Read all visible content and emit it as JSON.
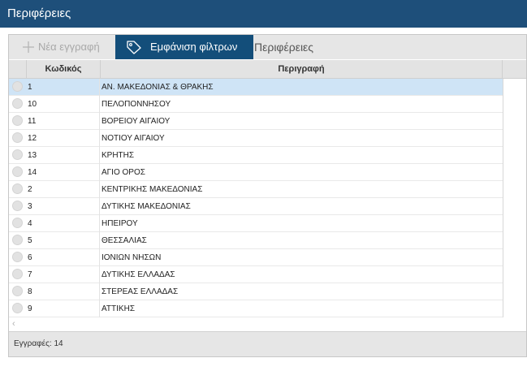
{
  "window": {
    "title": "Περιφέρειες"
  },
  "toolbar": {
    "new_label": "Νέα εγγραφή",
    "filter_label": "Εμφάνιση φίλτρων",
    "section_label": "Περιφέρειες"
  },
  "grid": {
    "columns": {
      "code": "Κωδικός",
      "description": "Περιγραφή"
    },
    "rows": [
      {
        "code": "1",
        "description": "ΑΝ. ΜΑΚΕΔΟΝΙΑΣ & ΘΡΑΚΗΣ",
        "selected": true
      },
      {
        "code": "10",
        "description": "ΠΕΛΟΠΟΝΝΗΣΟΥ"
      },
      {
        "code": "11",
        "description": "ΒΟΡΕΙΟΥ ΑΙΓΑΙΟΥ"
      },
      {
        "code": "12",
        "description": "ΝΟΤΙΟΥ ΑΙΓΑΙΟΥ"
      },
      {
        "code": "13",
        "description": "ΚΡΗΤΗΣ"
      },
      {
        "code": "14",
        "description": "ΑΓΙΟ ΟΡΟΣ"
      },
      {
        "code": "2",
        "description": "ΚΕΝΤΡΙΚΗΣ ΜΑΚΕΔΟΝΙΑΣ"
      },
      {
        "code": "3",
        "description": "ΔΥΤΙΚΗΣ ΜΑΚΕΔΟΝΙΑΣ"
      },
      {
        "code": "4",
        "description": "ΗΠΕΙΡΟΥ"
      },
      {
        "code": "5",
        "description": "ΘΕΣΣΑΛΙΑΣ"
      },
      {
        "code": "6",
        "description": "ΙΟΝΙΩΝ ΝΗΣΩΝ"
      },
      {
        "code": "7",
        "description": "ΔΥΤΙΚΗΣ ΕΛΛΑΔΑΣ"
      },
      {
        "code": "8",
        "description": "ΣΤΕΡΕΑΣ ΕΛΛΑΔΑΣ"
      },
      {
        "code": "9",
        "description": "ΑΤΤΙΚΗΣ"
      }
    ]
  },
  "footer": {
    "records_text": "Εγγραφές: 14"
  },
  "icons": {
    "new": "plus-icon",
    "filter": "tag-icon",
    "scroll_left": "chevron-left-icon"
  },
  "colors": {
    "titlebar": "#1e4f7a",
    "active_button": "#134e7a",
    "selected_row": "#cfe4f6"
  }
}
